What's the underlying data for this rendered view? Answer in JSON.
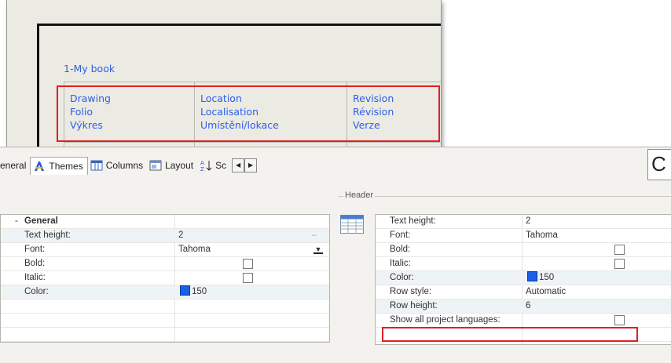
{
  "canvas": {
    "book_title": "1-My book",
    "columns": [
      {
        "lines": [
          "Drawing",
          "Folio",
          "Výkres"
        ]
      },
      {
        "lines": [
          "Location",
          "Localisation",
          "Umístění/lokace"
        ]
      },
      {
        "lines": [
          "Revision",
          "Révision",
          "Verze"
        ]
      }
    ]
  },
  "tabs": [
    {
      "label": "eneral",
      "icon": "general-tab-icon",
      "active": false
    },
    {
      "label": "Themes",
      "icon": "themes-icon",
      "active": true
    },
    {
      "label": "Columns",
      "icon": "columns-icon",
      "active": false
    },
    {
      "label": "Layout",
      "icon": "layout-icon",
      "active": false
    },
    {
      "label": "Sc",
      "icon": "sort-icon",
      "active": false
    }
  ],
  "topright_button_text": "C",
  "left_grid": {
    "group_toggle": "-",
    "group_label": "General",
    "rows": [
      {
        "label": "Text height:",
        "value": "2"
      },
      {
        "label": "Font:",
        "value": "Tahoma"
      },
      {
        "label": "Bold:",
        "value": ""
      },
      {
        "label": "Italic:",
        "value": ""
      },
      {
        "label": "Color:",
        "value": "150"
      }
    ]
  },
  "header_group": {
    "legend": "Header",
    "rows": [
      {
        "label": "Text height:",
        "value": "2"
      },
      {
        "label": "Font:",
        "value": "Tahoma"
      },
      {
        "label": "Bold:",
        "value": ""
      },
      {
        "label": "Italic:",
        "value": ""
      },
      {
        "label": "Color:",
        "value": "150"
      },
      {
        "label": "Row style:",
        "value": "Automatic"
      },
      {
        "label": "Row height:",
        "value": "6"
      },
      {
        "label": "Show all project languages:",
        "value": ""
      }
    ]
  },
  "colors": {
    "link_blue": "#2f5ee8",
    "highlight_red": "#e02020",
    "swatch_blue": "#1a5fe6"
  }
}
